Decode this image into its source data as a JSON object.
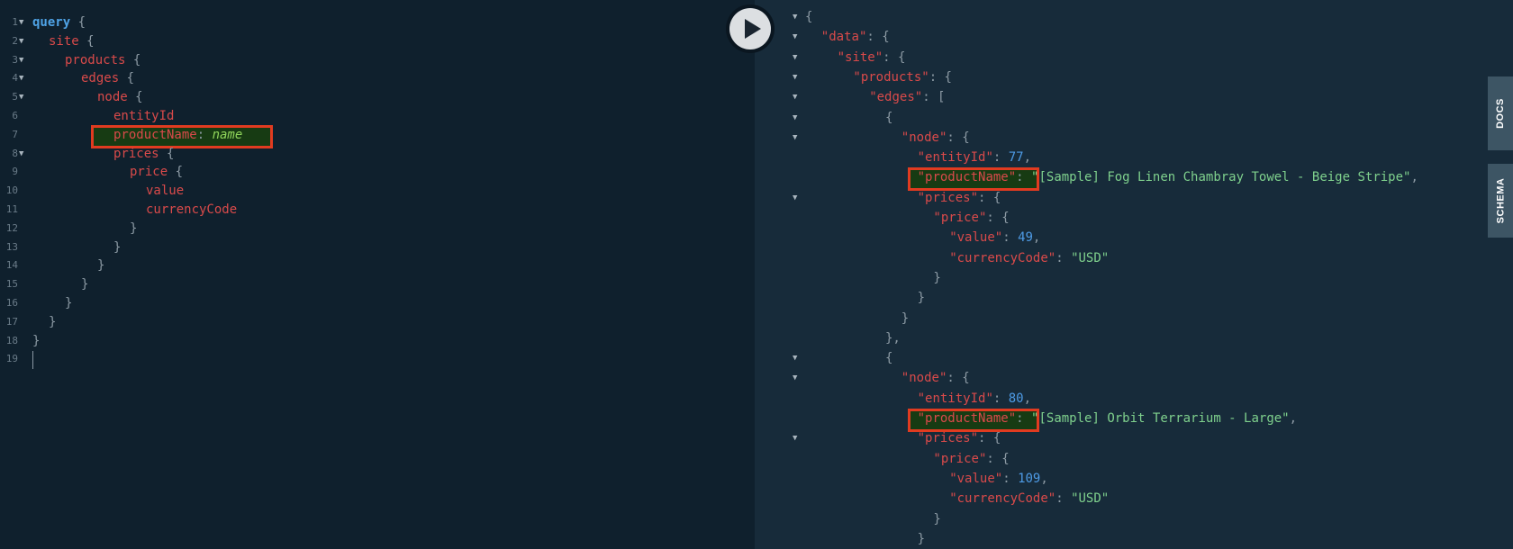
{
  "editor": {
    "line_numbers": [
      "1",
      "2",
      "3",
      "4",
      "5",
      "6",
      "7",
      "8",
      "9",
      "10",
      "11",
      "12",
      "13",
      "14",
      "15",
      "16",
      "17",
      "18",
      "19"
    ],
    "lines": [
      {
        "indent": 0,
        "parts": [
          {
            "t": "query",
            "c": "kw"
          },
          {
            "t": " {",
            "c": "punc"
          }
        ]
      },
      {
        "indent": 1,
        "parts": [
          {
            "t": "site",
            "c": "fld"
          },
          {
            "t": " {",
            "c": "punc"
          }
        ]
      },
      {
        "indent": 2,
        "parts": [
          {
            "t": "products",
            "c": "fld"
          },
          {
            "t": " {",
            "c": "punc"
          }
        ]
      },
      {
        "indent": 3,
        "parts": [
          {
            "t": "edges",
            "c": "fld"
          },
          {
            "t": " {",
            "c": "punc"
          }
        ]
      },
      {
        "indent": 4,
        "parts": [
          {
            "t": "node",
            "c": "fld"
          },
          {
            "t": " {",
            "c": "punc"
          }
        ]
      },
      {
        "indent": 5,
        "parts": [
          {
            "t": "entityId",
            "c": "fld"
          }
        ]
      },
      {
        "indent": 5,
        "parts": [
          {
            "t": "productName",
            "c": "fld"
          },
          {
            "t": ": ",
            "c": "punc"
          },
          {
            "t": "name",
            "c": "alias"
          }
        ]
      },
      {
        "indent": 5,
        "parts": [
          {
            "t": "prices",
            "c": "fld"
          },
          {
            "t": " {",
            "c": "punc"
          }
        ]
      },
      {
        "indent": 6,
        "parts": [
          {
            "t": "price",
            "c": "fld"
          },
          {
            "t": " {",
            "c": "punc"
          }
        ]
      },
      {
        "indent": 7,
        "parts": [
          {
            "t": "value",
            "c": "fld"
          }
        ]
      },
      {
        "indent": 7,
        "parts": [
          {
            "t": "currencyCode",
            "c": "fld"
          }
        ]
      },
      {
        "indent": 6,
        "parts": [
          {
            "t": "}",
            "c": "punc"
          }
        ]
      },
      {
        "indent": 5,
        "parts": [
          {
            "t": "}",
            "c": "punc"
          }
        ]
      },
      {
        "indent": 4,
        "parts": [
          {
            "t": "}",
            "c": "punc"
          }
        ]
      },
      {
        "indent": 3,
        "parts": [
          {
            "t": "}",
            "c": "punc"
          }
        ]
      },
      {
        "indent": 2,
        "parts": [
          {
            "t": "}",
            "c": "punc"
          }
        ]
      },
      {
        "indent": 1,
        "parts": [
          {
            "t": "}",
            "c": "punc"
          }
        ]
      },
      {
        "indent": 0,
        "parts": [
          {
            "t": "}",
            "c": "punc"
          }
        ]
      },
      {
        "indent": 0,
        "parts": []
      }
    ],
    "fold_lines": [
      0,
      1,
      2,
      3,
      4,
      7
    ]
  },
  "results": {
    "lines": [
      {
        "indent": 0,
        "fold": true,
        "parts": [
          {
            "t": "{",
            "c": "punc"
          }
        ]
      },
      {
        "indent": 1,
        "fold": true,
        "parts": [
          {
            "t": "\"data\"",
            "c": "key"
          },
          {
            "t": ": {",
            "c": "punc"
          }
        ]
      },
      {
        "indent": 2,
        "fold": true,
        "parts": [
          {
            "t": "\"site\"",
            "c": "key"
          },
          {
            "t": ": {",
            "c": "punc"
          }
        ]
      },
      {
        "indent": 3,
        "fold": true,
        "parts": [
          {
            "t": "\"products\"",
            "c": "key"
          },
          {
            "t": ": {",
            "c": "punc"
          }
        ]
      },
      {
        "indent": 4,
        "fold": true,
        "parts": [
          {
            "t": "\"edges\"",
            "c": "key"
          },
          {
            "t": ": [",
            "c": "punc"
          }
        ]
      },
      {
        "indent": 5,
        "fold": true,
        "parts": [
          {
            "t": "{",
            "c": "punc"
          }
        ]
      },
      {
        "indent": 6,
        "fold": true,
        "parts": [
          {
            "t": "\"node\"",
            "c": "key"
          },
          {
            "t": ": {",
            "c": "punc"
          }
        ]
      },
      {
        "indent": 7,
        "fold": false,
        "parts": [
          {
            "t": "\"entityId\"",
            "c": "key"
          },
          {
            "t": ": ",
            "c": "punc"
          },
          {
            "t": "77",
            "c": "num"
          },
          {
            "t": ",",
            "c": "punc"
          }
        ]
      },
      {
        "indent": 7,
        "fold": false,
        "parts": [
          {
            "t": "\"productName\"",
            "c": "key"
          },
          {
            "t": ": ",
            "c": "punc"
          },
          {
            "t": "\"[Sample] Fog Linen Chambray Towel - Beige Stripe\"",
            "c": "str"
          },
          {
            "t": ",",
            "c": "punc"
          }
        ]
      },
      {
        "indent": 7,
        "fold": true,
        "parts": [
          {
            "t": "\"prices\"",
            "c": "key"
          },
          {
            "t": ": {",
            "c": "punc"
          }
        ]
      },
      {
        "indent": 8,
        "fold": false,
        "parts": [
          {
            "t": "\"price\"",
            "c": "key"
          },
          {
            "t": ": {",
            "c": "punc"
          }
        ]
      },
      {
        "indent": 9,
        "fold": false,
        "parts": [
          {
            "t": "\"value\"",
            "c": "key"
          },
          {
            "t": ": ",
            "c": "punc"
          },
          {
            "t": "49",
            "c": "num"
          },
          {
            "t": ",",
            "c": "punc"
          }
        ]
      },
      {
        "indent": 9,
        "fold": false,
        "parts": [
          {
            "t": "\"currencyCode\"",
            "c": "key"
          },
          {
            "t": ": ",
            "c": "punc"
          },
          {
            "t": "\"USD\"",
            "c": "str"
          }
        ]
      },
      {
        "indent": 8,
        "fold": false,
        "parts": [
          {
            "t": "}",
            "c": "punc"
          }
        ]
      },
      {
        "indent": 7,
        "fold": false,
        "parts": [
          {
            "t": "}",
            "c": "punc"
          }
        ]
      },
      {
        "indent": 6,
        "fold": false,
        "parts": [
          {
            "t": "}",
            "c": "punc"
          }
        ]
      },
      {
        "indent": 5,
        "fold": false,
        "parts": [
          {
            "t": "},",
            "c": "punc"
          }
        ]
      },
      {
        "indent": 5,
        "fold": true,
        "parts": [
          {
            "t": "{",
            "c": "punc"
          }
        ]
      },
      {
        "indent": 6,
        "fold": true,
        "parts": [
          {
            "t": "\"node\"",
            "c": "key"
          },
          {
            "t": ": {",
            "c": "punc"
          }
        ]
      },
      {
        "indent": 7,
        "fold": false,
        "parts": [
          {
            "t": "\"entityId\"",
            "c": "key"
          },
          {
            "t": ": ",
            "c": "punc"
          },
          {
            "t": "80",
            "c": "num"
          },
          {
            "t": ",",
            "c": "punc"
          }
        ]
      },
      {
        "indent": 7,
        "fold": false,
        "parts": [
          {
            "t": "\"productName\"",
            "c": "key"
          },
          {
            "t": ": ",
            "c": "punc"
          },
          {
            "t": "\"[Sample] Orbit Terrarium - Large\"",
            "c": "str"
          },
          {
            "t": ",",
            "c": "punc"
          }
        ]
      },
      {
        "indent": 7,
        "fold": true,
        "parts": [
          {
            "t": "\"prices\"",
            "c": "key"
          },
          {
            "t": ": {",
            "c": "punc"
          }
        ]
      },
      {
        "indent": 8,
        "fold": false,
        "parts": [
          {
            "t": "\"price\"",
            "c": "key"
          },
          {
            "t": ": {",
            "c": "punc"
          }
        ]
      },
      {
        "indent": 9,
        "fold": false,
        "parts": [
          {
            "t": "\"value\"",
            "c": "key"
          },
          {
            "t": ": ",
            "c": "punc"
          },
          {
            "t": "109",
            "c": "num"
          },
          {
            "t": ",",
            "c": "punc"
          }
        ]
      },
      {
        "indent": 9,
        "fold": false,
        "parts": [
          {
            "t": "\"currencyCode\"",
            "c": "key"
          },
          {
            "t": ": ",
            "c": "punc"
          },
          {
            "t": "\"USD\"",
            "c": "str"
          }
        ]
      },
      {
        "indent": 8,
        "fold": false,
        "parts": [
          {
            "t": "}",
            "c": "punc"
          }
        ]
      },
      {
        "indent": 7,
        "fold": false,
        "parts": [
          {
            "t": "}",
            "c": "punc"
          }
        ]
      }
    ]
  },
  "toolbar": {
    "run_icon": "play-icon"
  },
  "side_tabs": {
    "docs_label": "DOCS",
    "schema_label": "SCHEMA"
  },
  "colors": {
    "editor_bg": "#0f202d",
    "results_bg": "#172b3a",
    "highlight_border": "#e13b20",
    "keyword": "#4fa3e6",
    "field": "#d94a4a",
    "string": "#7fd18d",
    "number": "#4e9be6"
  }
}
